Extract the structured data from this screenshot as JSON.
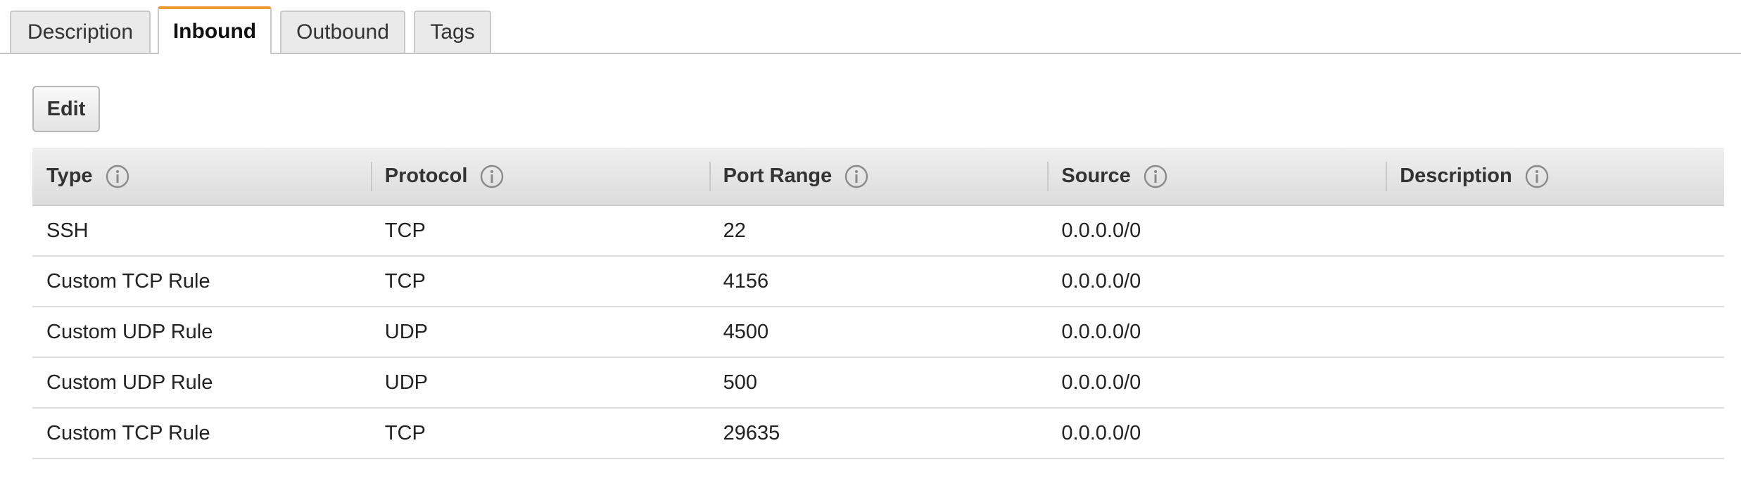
{
  "tabs": [
    {
      "label": "Description"
    },
    {
      "label": "Inbound"
    },
    {
      "label": "Outbound"
    },
    {
      "label": "Tags"
    }
  ],
  "active_tab": "Inbound",
  "accent_color": "#ec9a34",
  "toolbar": {
    "edit_label": "Edit"
  },
  "table": {
    "columns": [
      {
        "label": "Type",
        "icon": "info-icon"
      },
      {
        "label": "Protocol",
        "icon": "info-icon"
      },
      {
        "label": "Port Range",
        "icon": "info-icon"
      },
      {
        "label": "Source",
        "icon": "info-icon"
      },
      {
        "label": "Description",
        "icon": "info-icon"
      }
    ],
    "rows": [
      {
        "type": "SSH",
        "protocol": "TCP",
        "port_range": "22",
        "source": "0.0.0.0/0",
        "description": ""
      },
      {
        "type": "Custom TCP Rule",
        "protocol": "TCP",
        "port_range": "4156",
        "source": "0.0.0.0/0",
        "description": ""
      },
      {
        "type": "Custom UDP Rule",
        "protocol": "UDP",
        "port_range": "4500",
        "source": "0.0.0.0/0",
        "description": ""
      },
      {
        "type": "Custom UDP Rule",
        "protocol": "UDP",
        "port_range": "500",
        "source": "0.0.0.0/0",
        "description": ""
      },
      {
        "type": "Custom TCP Rule",
        "protocol": "TCP",
        "port_range": "29635",
        "source": "0.0.0.0/0",
        "description": ""
      }
    ]
  }
}
